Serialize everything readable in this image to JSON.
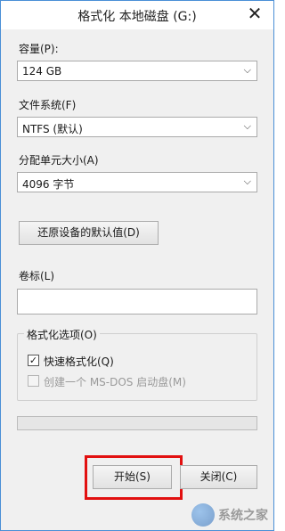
{
  "window": {
    "title": "格式化 本地磁盘 (G:)",
    "close_glyph": "✕"
  },
  "capacity": {
    "label": "容量(P):",
    "value": "124 GB"
  },
  "filesystem": {
    "label": "文件系统(F)",
    "value": "NTFS (默认)"
  },
  "allocation": {
    "label": "分配单元大小(A)",
    "value": "4096 字节"
  },
  "restore_button": "还原设备的默认值(D)",
  "volume_label": {
    "label": "卷标(L)",
    "value": ""
  },
  "format_options": {
    "title": "格式化选项(O)",
    "quick_format": {
      "label": "快速格式化(Q)",
      "checked": true
    },
    "msdos_disk": {
      "label": "创建一个 MS-DOS 启动盘(M)",
      "checked": false,
      "enabled": false
    }
  },
  "progress": {
    "percent": 0
  },
  "buttons": {
    "start": "开始(S)",
    "close": "关闭(C)"
  },
  "icons": {
    "chevron": "chevron-down-icon",
    "check": "checkmark-icon"
  },
  "colors": {
    "highlight": "#e21010",
    "window_border": "#4a8fd6"
  },
  "watermark": {
    "text": "系统之家"
  }
}
